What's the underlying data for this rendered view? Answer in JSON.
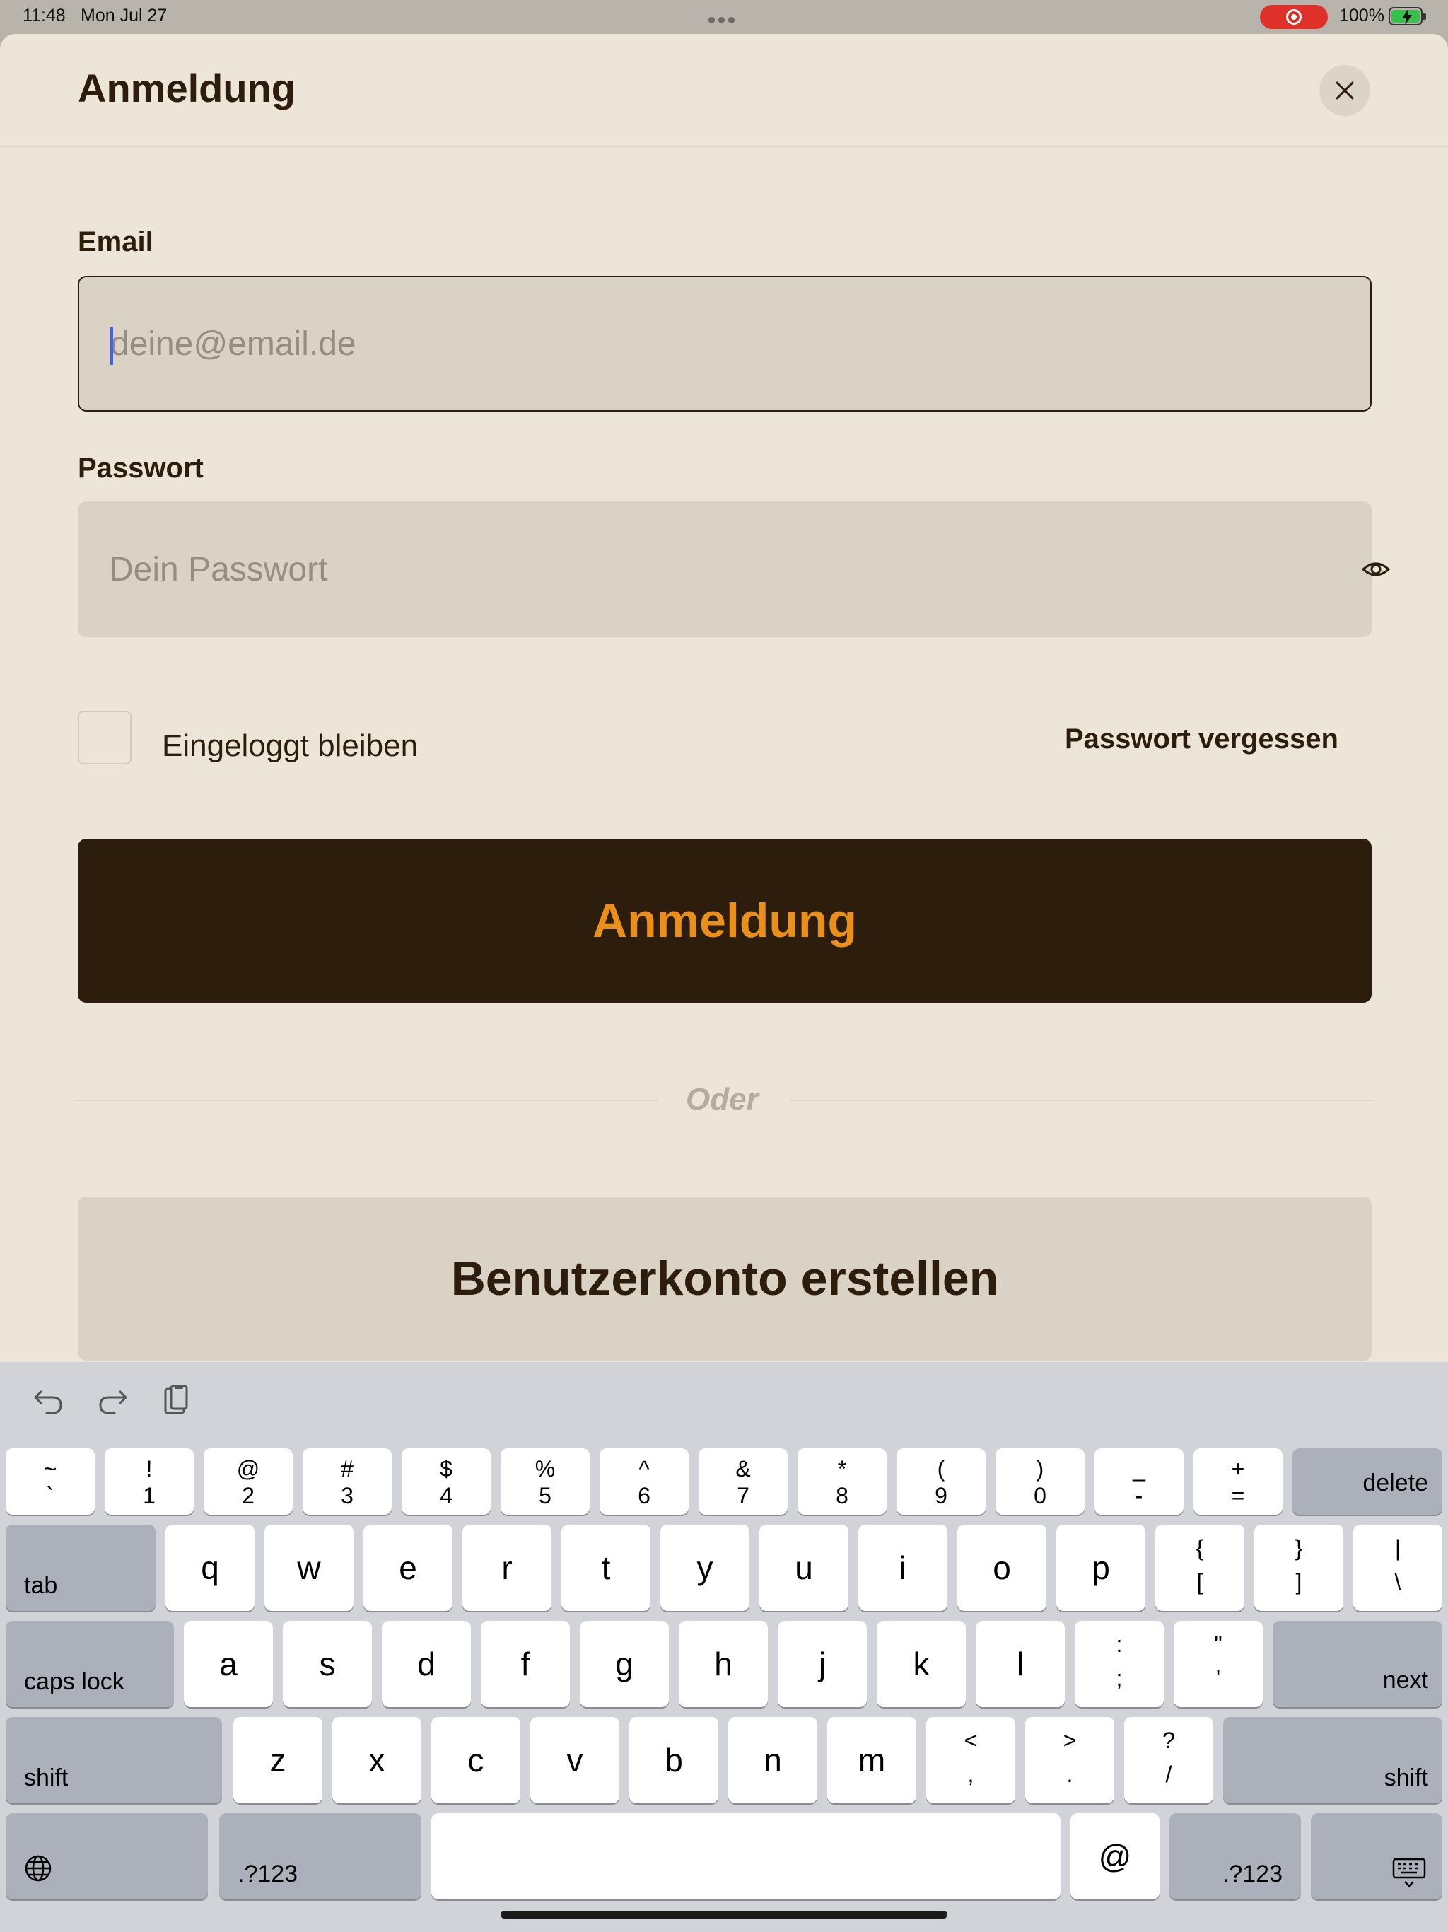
{
  "status_bar": {
    "time": "11:48",
    "date": "Mon Jul 27",
    "battery": "100%"
  },
  "sheet": {
    "title": "Anmeldung",
    "email_label": "Email",
    "email_placeholder": "deine@email.de",
    "password_label": "Passwort",
    "password_placeholder": "Dein Passwort",
    "remember_label": "Eingeloggt bleiben",
    "forgot_label": "Passwort vergessen",
    "login_button": "Anmeldung",
    "divider": "Oder",
    "register_button": "Benutzerkonto erstellen"
  },
  "colors": {
    "background": "#ede5d8",
    "field": "#dad2c5",
    "primary": "#2c1d0d",
    "accent": "#e88f1c"
  },
  "keyboard": {
    "row1": [
      {
        "top": "~",
        "bot": "`"
      },
      {
        "top": "!",
        "bot": "1"
      },
      {
        "top": "@",
        "bot": "2"
      },
      {
        "top": "#",
        "bot": "3"
      },
      {
        "top": "$",
        "bot": "4"
      },
      {
        "top": "%",
        "bot": "5"
      },
      {
        "top": "^",
        "bot": "6"
      },
      {
        "top": "&",
        "bot": "7"
      },
      {
        "top": "*",
        "bot": "8"
      },
      {
        "top": "(",
        "bot": "9"
      },
      {
        "top": ")",
        "bot": "0"
      },
      {
        "top": "_",
        "bot": "-"
      },
      {
        "top": "+",
        "bot": "="
      }
    ],
    "delete": "delete",
    "tab": "tab",
    "row2": [
      "q",
      "w",
      "e",
      "r",
      "t",
      "y",
      "u",
      "i",
      "o",
      "p"
    ],
    "row2_sym": [
      {
        "top": "{",
        "bot": "["
      },
      {
        "top": "}",
        "bot": "]"
      },
      {
        "top": "|",
        "bot": "\\"
      }
    ],
    "caps": "caps lock",
    "row3": [
      "a",
      "s",
      "d",
      "f",
      "g",
      "h",
      "j",
      "k",
      "l"
    ],
    "row3_sym": [
      {
        "top": ":",
        "bot": ";"
      },
      {
        "top": "\"",
        "bot": "'"
      }
    ],
    "next": "next",
    "shift": "shift",
    "row4": [
      "z",
      "x",
      "c",
      "v",
      "b",
      "n",
      "m"
    ],
    "row4_sym": [
      {
        "top": "<",
        "bot": ","
      },
      {
        "top": ">",
        "bot": "."
      },
      {
        "top": "?",
        "bot": "/"
      }
    ],
    "numbers": ".?123",
    "at": "@"
  }
}
